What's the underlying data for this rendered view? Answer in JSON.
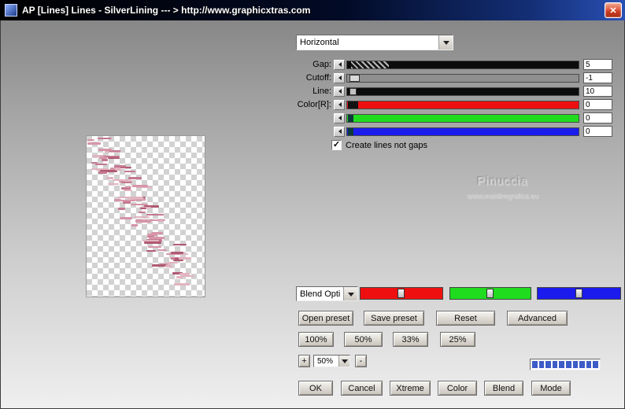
{
  "window": {
    "title": "AP [Lines]  Lines - SilverLining   --- > http://www.graphicxtras.com",
    "close_glyph": "✕"
  },
  "colors": {
    "slider_black": "#0c0c0c",
    "slider_gray": "#8f8f8f",
    "red": "#ee1010",
    "green": "#1fdc1f",
    "blue": "#1b1bee",
    "progress_blue": "#3d5cc8"
  },
  "panel": {
    "direction_value": "Horizontal",
    "rows": [
      {
        "label": "Gap:",
        "value": "5"
      },
      {
        "label": "Cutoff:",
        "value": "-1"
      },
      {
        "label": "Line:",
        "value": "10"
      },
      {
        "label": "Color[R]:",
        "value": "0"
      },
      {
        "label": "",
        "value": "0"
      },
      {
        "label": "",
        "value": "0"
      }
    ],
    "checkbox_label": "Create lines not gaps",
    "checkbox_checked": true,
    "check_glyph": "✓",
    "blend_value": "Blend Opti",
    "buttons": {
      "open_preset": "Open preset",
      "save_preset": "Save preset",
      "reset": "Reset",
      "advanced": "Advanced",
      "pct_100": "100%",
      "pct_50": "50%",
      "pct_33": "33%",
      "pct_25": "25%",
      "plus": "+",
      "zoom_value": "50%",
      "minus": "-",
      "ok": "OK",
      "cancel": "Cancel",
      "xtreme": "Xtreme",
      "color": "Color",
      "blend": "Blend",
      "mode": "Mode"
    }
  },
  "watermark": {
    "line1": "Pinuccia",
    "line2": "www.maidiregrafica.eu"
  },
  "preview": {
    "dash_colors": [
      "#d695a8",
      "#c4788f",
      "#b05a73",
      "#e2b4c0"
    ]
  },
  "progress": {
    "filled": 10,
    "total": 10
  }
}
